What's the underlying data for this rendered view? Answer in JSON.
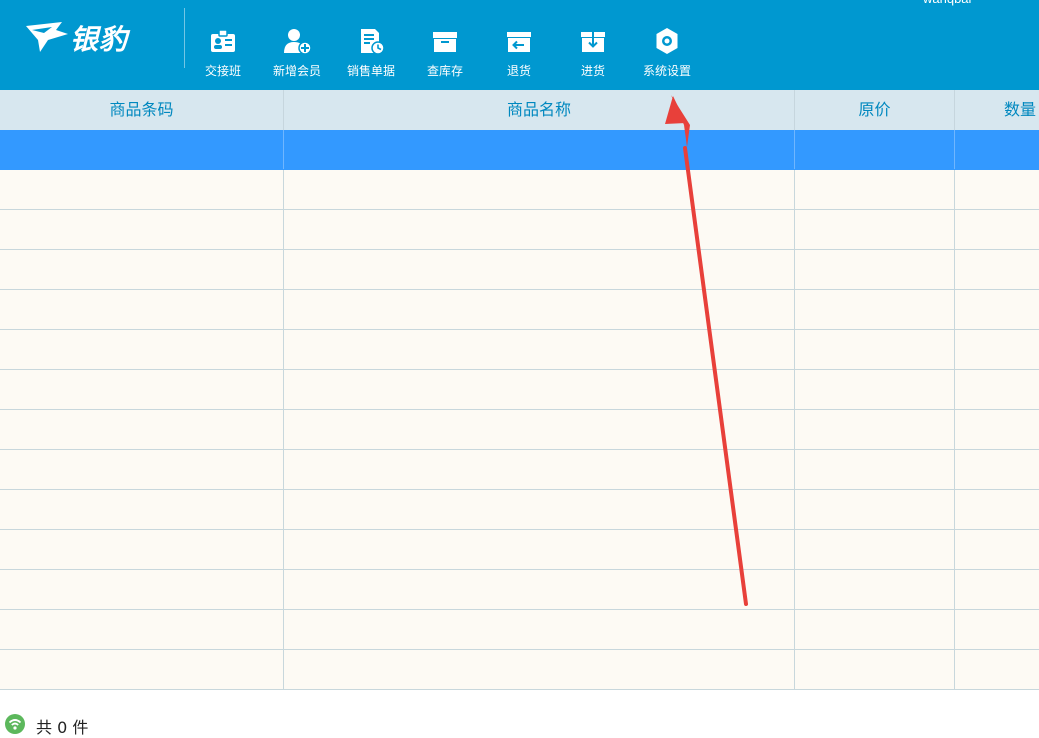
{
  "app": {
    "brand": "银豹",
    "user": "wanqbai"
  },
  "toolbar": {
    "items": [
      {
        "label": "交接班",
        "icon": "handover-icon"
      },
      {
        "label": "新增会员",
        "icon": "add-member-icon"
      },
      {
        "label": "销售单据",
        "icon": "sales-receipt-icon"
      },
      {
        "label": "查库存",
        "icon": "inventory-box-icon"
      },
      {
        "label": "退货",
        "icon": "return-goods-icon"
      },
      {
        "label": "进货",
        "icon": "purchase-goods-icon"
      },
      {
        "label": "系统设置",
        "icon": "gear-icon"
      }
    ]
  },
  "grid": {
    "columns": [
      "商品条码",
      "商品名称",
      "原价",
      "数量"
    ],
    "row_count": 14,
    "selected_row": 0
  },
  "footer": {
    "count_text": "共 0 件"
  },
  "colors": {
    "toolbar_bg": "#0098d0",
    "header_bg": "#d7e7ef",
    "selected_row": "#3399ff",
    "annotation_arrow": "#e8403a"
  }
}
